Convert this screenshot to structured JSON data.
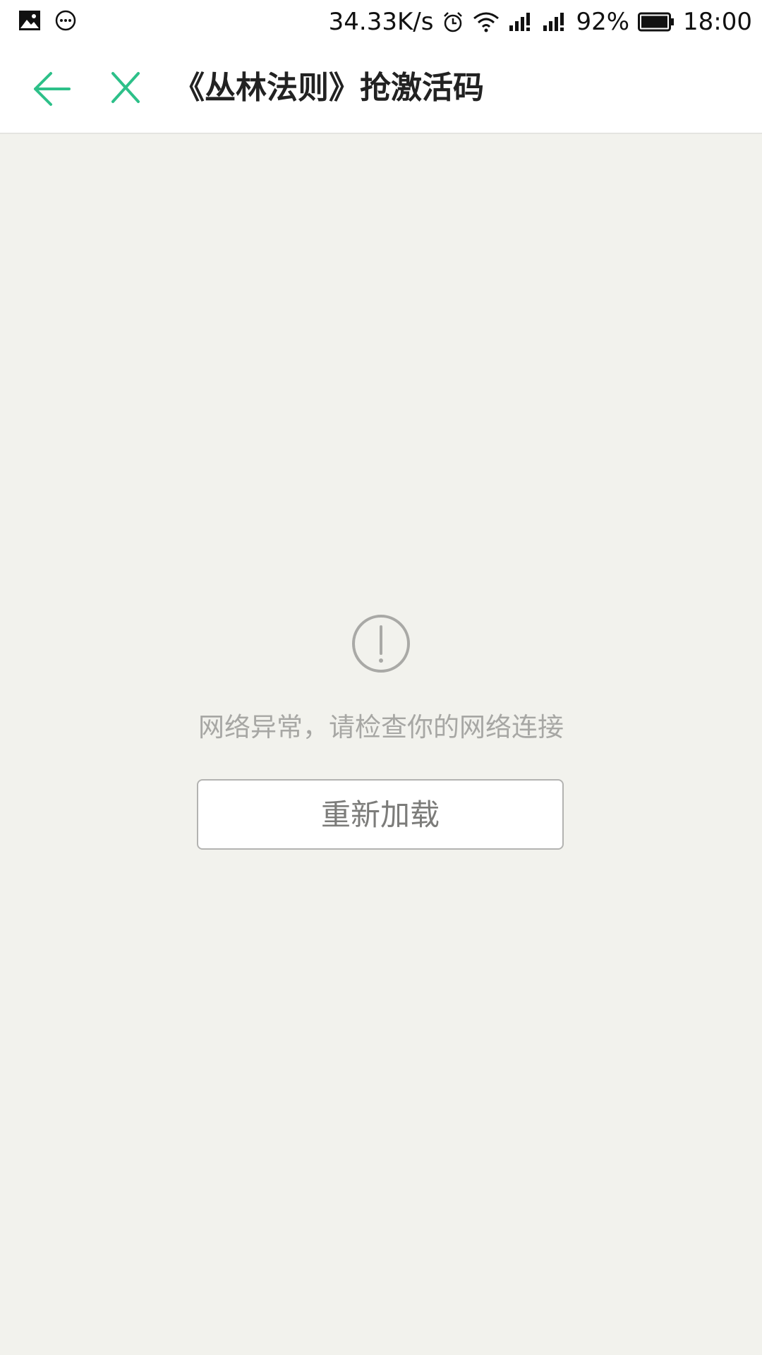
{
  "status_bar": {
    "net_speed": "34.33K/s",
    "battery_percent": "92%",
    "time": "18:00",
    "icons": [
      "gallery-icon",
      "message-icon",
      "alarm-icon",
      "wifi-icon",
      "signal-1-icon",
      "signal-2-icon",
      "battery-icon"
    ]
  },
  "nav": {
    "title": "《丛林法则》抢激活码",
    "accent_color": "#2dc089"
  },
  "error": {
    "icon": "alert-circle-icon",
    "message": "网络异常，请检查你的网络连接",
    "reload_label": "重新加载"
  },
  "colors": {
    "background": "#f2f2ed",
    "header_bg": "#ffffff",
    "muted_text": "#a7a7a4"
  }
}
